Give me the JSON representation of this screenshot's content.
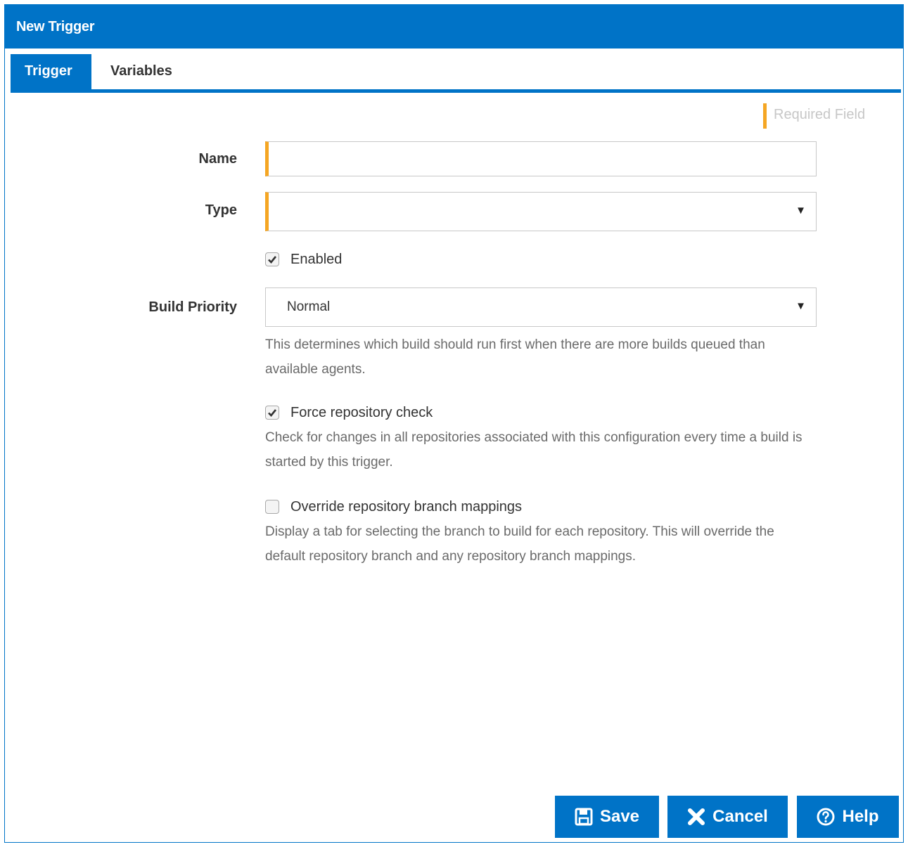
{
  "dialog": {
    "title": "New Trigger"
  },
  "tabs": [
    {
      "label": "Trigger",
      "active": true
    },
    {
      "label": "Variables",
      "active": false
    }
  ],
  "required_hint": "Required Field",
  "form": {
    "name": {
      "label": "Name",
      "value": ""
    },
    "type": {
      "label": "Type",
      "value": ""
    },
    "enabled": {
      "label": "Enabled",
      "checked": true
    },
    "build_priority": {
      "label": "Build Priority",
      "value": "Normal",
      "help": "This determines which build should run first when there are more builds queued than available agents."
    },
    "force_repo_check": {
      "label": "Force repository check",
      "checked": true,
      "help": "Check for changes in all repositories associated with this configuration every time a build is started by this trigger."
    },
    "override_branch": {
      "label": "Override repository branch mappings",
      "checked": false,
      "help": "Display a tab for selecting the branch to build for each repository. This will override the default repository branch and any repository branch mappings."
    }
  },
  "buttons": {
    "save": "Save",
    "cancel": "Cancel",
    "help": "Help"
  },
  "colors": {
    "primary": "#0073c7",
    "required": "#f5a623"
  }
}
